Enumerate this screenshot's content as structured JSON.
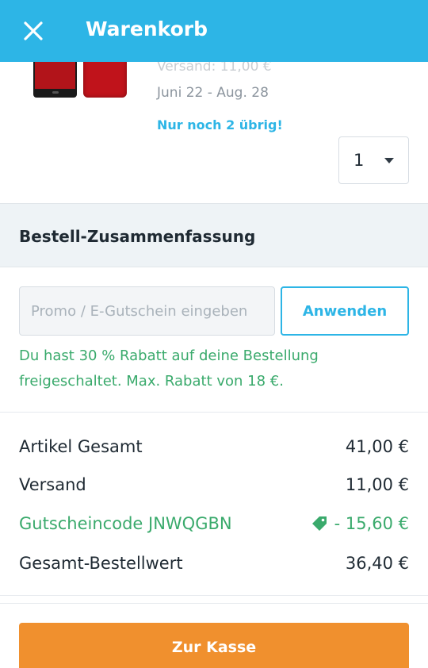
{
  "header": {
    "title": "Warenkorb",
    "close_icon": "close-icon",
    "background": "#2db5e6"
  },
  "product": {
    "shipping_faded": "Versand: 11,00 €",
    "delivery_range": "Juni 22 - Aug. 28",
    "stock_note": "Nur noch 2 übrig!",
    "quantity": "1"
  },
  "summary": {
    "title": "Bestell-Zusammenfassung",
    "promo_placeholder": "Promo / E-Gutschein eingeben",
    "apply_label": "Anwenden",
    "discount_message": "Du hast 30 % Rabatt auf deine Bestellung freigeschaltet. Max. Rabatt von 18 €.",
    "rows": [
      {
        "label": "Artikel Gesamt",
        "value": "41,00 €"
      },
      {
        "label": "Versand",
        "value": "11,00 €"
      },
      {
        "label": "Gutscheincode JNWQGBN",
        "value": "- 15,60 €",
        "icon": "tag-icon"
      },
      {
        "label": "Gesamt-Bestellwert",
        "value": "36,40 €"
      }
    ]
  },
  "checkout": {
    "label": "Zur Kasse",
    "color": "#f0902e"
  },
  "colors": {
    "accent": "#2db5e6",
    "success": "#3aaa6c"
  }
}
